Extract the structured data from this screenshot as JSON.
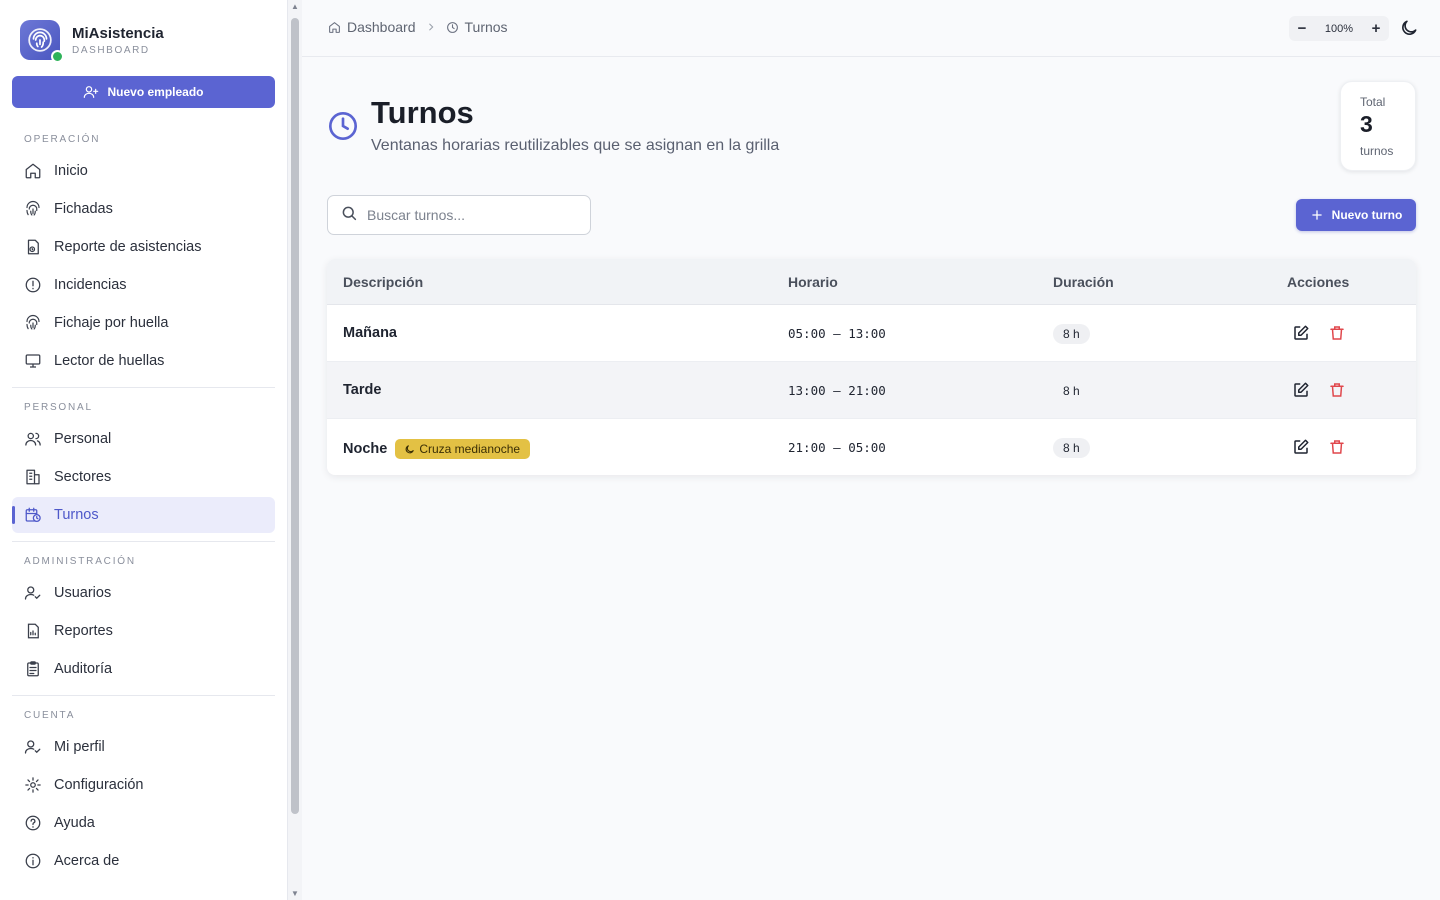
{
  "brand": {
    "name": "MiAsistencia",
    "subtitle": "DASHBOARD"
  },
  "sidebar": {
    "new_employee_label": "Nuevo empleado",
    "sections": [
      {
        "label": "OPERACIÓN",
        "items": [
          "Inicio",
          "Fichadas",
          "Reporte de asistencias",
          "Incidencias",
          "Fichaje por huella",
          "Lector de huellas"
        ]
      },
      {
        "label": "PERSONAL",
        "items": [
          "Personal",
          "Sectores",
          "Turnos"
        ]
      },
      {
        "label": "ADMINISTRACIÓN",
        "items": [
          "Usuarios",
          "Reportes",
          "Auditoría"
        ]
      },
      {
        "label": "CUENTA",
        "items": [
          "Mi perfil",
          "Configuración",
          "Ayuda",
          "Acerca de"
        ]
      }
    ],
    "active_item": "Turnos"
  },
  "topbar": {
    "breadcrumb": [
      "Dashboard",
      "Turnos"
    ],
    "zoom_level": "100%",
    "zoom_out": "−",
    "zoom_in": "+"
  },
  "page": {
    "title": "Turnos",
    "subtitle": "Ventanas horarias reutilizables que se asignan en la grilla",
    "total": {
      "label": "Total",
      "value": "3",
      "unit": "turnos"
    }
  },
  "toolbar": {
    "search_placeholder": "Buscar turnos...",
    "new_shift_label": "Nuevo turno"
  },
  "table": {
    "columns": [
      "Descripción",
      "Horario",
      "Duración",
      "Acciones"
    ],
    "rows": [
      {
        "description": "Mañana",
        "badge": "",
        "schedule": "05:00 – 13:00",
        "duration": "8 h"
      },
      {
        "description": "Tarde",
        "badge": "",
        "schedule": "13:00 – 21:00",
        "duration": "8 h"
      },
      {
        "description": "Noche",
        "badge": "Cruza medianoche",
        "schedule": "21:00 – 05:00",
        "duration": "8 h"
      }
    ]
  },
  "colors": {
    "accent": "#5b64d2",
    "delete": "#e0474c",
    "badge": "#e3c144",
    "online": "#2fb35a"
  },
  "icons": {
    "nav": [
      "home-icon",
      "fingerprint-icon",
      "report-icon",
      "alert-circle-icon",
      "fingerprint-icon",
      "monitor-icon",
      "users-icon",
      "building-icon",
      "calendar-clock-icon",
      "user-check-icon",
      "file-chart-icon",
      "clipboard-icon",
      "user-check-icon",
      "gear-icon",
      "help-circle-icon",
      "info-icon"
    ]
  }
}
